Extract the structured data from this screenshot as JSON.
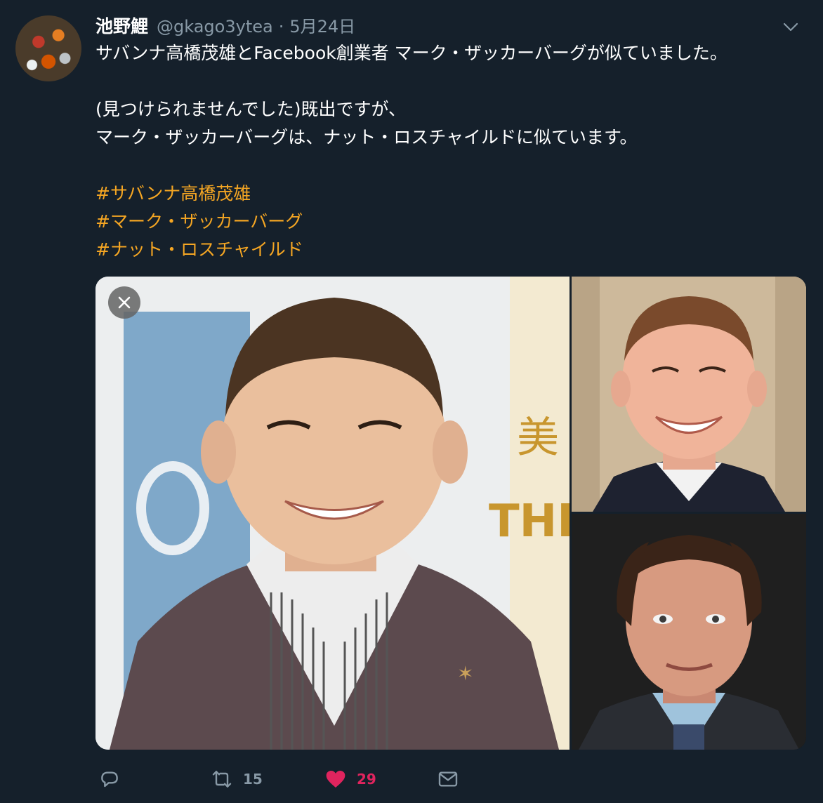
{
  "user": {
    "display_name": "池野鯉",
    "handle": "@gkago3ytea",
    "separator": "·",
    "date": "5月24日"
  },
  "tweet": {
    "lines": [
      "サバンナ高橋茂雄とFacebook創業者 マーク・ザッカーバーグが似ていました。",
      "(見つけられませんでした)既出ですが、",
      "マーク・ザッカーバーグは、ナット・ロスチャイルドに似ています。"
    ],
    "hashtags": [
      "#サバンナ高橋茂雄",
      "#マーク・ザッカーバーグ",
      "#ナット・ロスチャイルド"
    ]
  },
  "media": {
    "main_photo_sign_text": "美",
    "main_photo_sign_text2": "THE"
  },
  "actions": {
    "reply_count": "",
    "retweet_count": "15",
    "like_count": "29"
  },
  "colors": {
    "background": "#15202b",
    "secondary_text": "#8899a6",
    "hashtag": "#f5a623",
    "like": "#e0245e"
  },
  "icons": {
    "caret": "chevron-down-icon",
    "close": "close-icon",
    "reply": "reply-icon",
    "retweet": "retweet-icon",
    "like": "heart-icon",
    "dm": "envelope-icon"
  }
}
